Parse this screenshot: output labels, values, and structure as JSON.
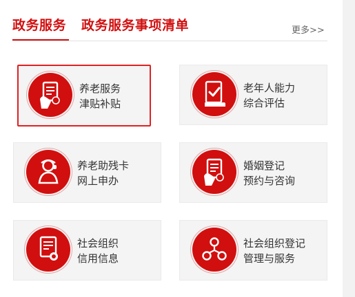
{
  "tabs": [
    {
      "label": "政务服务"
    },
    {
      "label": "政务服务事项清单"
    }
  ],
  "more_label": "更多>>",
  "accent_color": "#d10f0f",
  "cards": [
    {
      "line1": "养老服务",
      "line2": "津贴补贴",
      "icon": "document-hand-icon",
      "selected": true
    },
    {
      "line1": "老年人能力",
      "line2": "综合评估",
      "icon": "checklist-icon"
    },
    {
      "line1": "养老助残卡",
      "line2": "网上申办",
      "icon": "user-service-icon"
    },
    {
      "line1": "婚姻登记",
      "line2": "预约与咨询",
      "icon": "document-hand-icon"
    },
    {
      "line1": "社会组织",
      "line2": "信用信息",
      "icon": "credit-document-icon"
    },
    {
      "line1": "社会组织登记",
      "line2": "管理与服务",
      "icon": "org-network-icon"
    }
  ]
}
